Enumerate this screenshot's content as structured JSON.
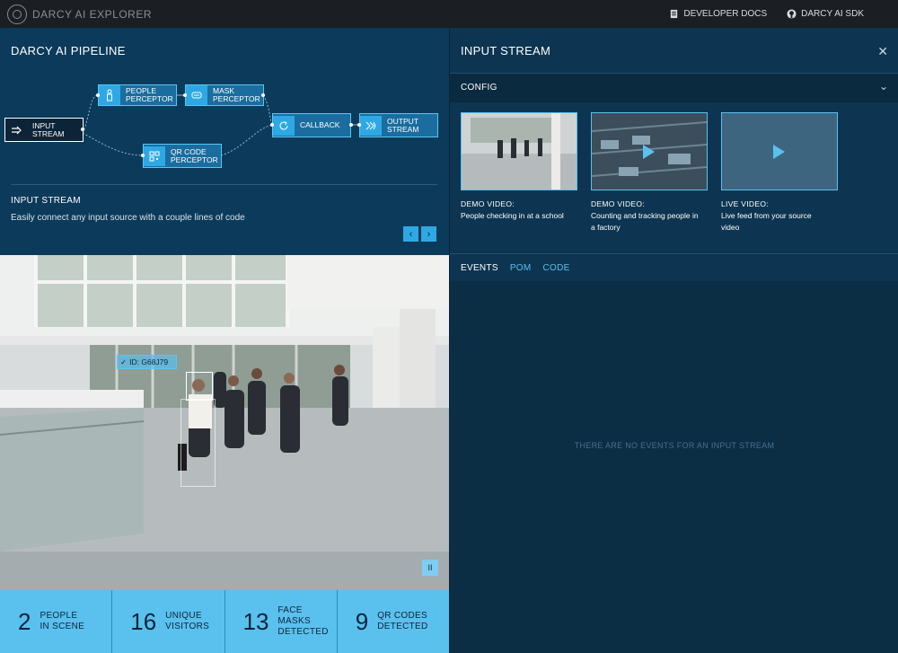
{
  "app": {
    "title": "DARCY AI EXPLORER"
  },
  "topnav": {
    "docs": "DEVELOPER DOCS",
    "sdk": "DARCY AI SDK"
  },
  "pipeline": {
    "title": "DARCY AI PIPELINE",
    "nodes": {
      "input": [
        "INPUT",
        "STREAM"
      ],
      "people": [
        "PEOPLE",
        "PERCEPTOR"
      ],
      "mask": [
        "MASK",
        "PERCEPTOR"
      ],
      "qr": [
        "QR CODE",
        "PERCEPTOR"
      ],
      "callback": "CALLBACK",
      "output": [
        "OUTPUT",
        "STREAM"
      ]
    },
    "selected_heading": "INPUT STREAM",
    "selected_description": "Easily connect any input source with a couple lines of code",
    "prev": "‹",
    "next": "›"
  },
  "video": {
    "id_tag": "ID: G68J79",
    "pause": "II"
  },
  "stats": [
    {
      "value": "2",
      "label1": "PEOPLE",
      "label2": "IN SCENE"
    },
    {
      "value": "16",
      "label1": "UNIQUE",
      "label2": "VISITORS"
    },
    {
      "value": "13",
      "label1": "FACE MASKS",
      "label2": "DETECTED"
    },
    {
      "value": "9",
      "label1": "QR CODES",
      "label2": "DETECTED"
    }
  ],
  "panel": {
    "title": "INPUT STREAM",
    "close": "✕",
    "config_label": "CONFIG",
    "config_chevron": "⌄",
    "sources": [
      {
        "title": "DEMO VIDEO:",
        "desc": "People checking in at a school"
      },
      {
        "title": "DEMO VIDEO:",
        "desc": "Counting and tracking people in a factory"
      },
      {
        "title": "LIVE VIDEO:",
        "desc": "Live feed from your source video"
      }
    ],
    "tabs": [
      "EVENTS",
      "POM",
      "CODE"
    ],
    "empty_message": "THERE ARE NO EVENTS FOR AN INPUT STREAM"
  },
  "colors": {
    "accent": "#5ac0ee",
    "panel": "#0b2e45",
    "topbar": "#1b1e22"
  }
}
